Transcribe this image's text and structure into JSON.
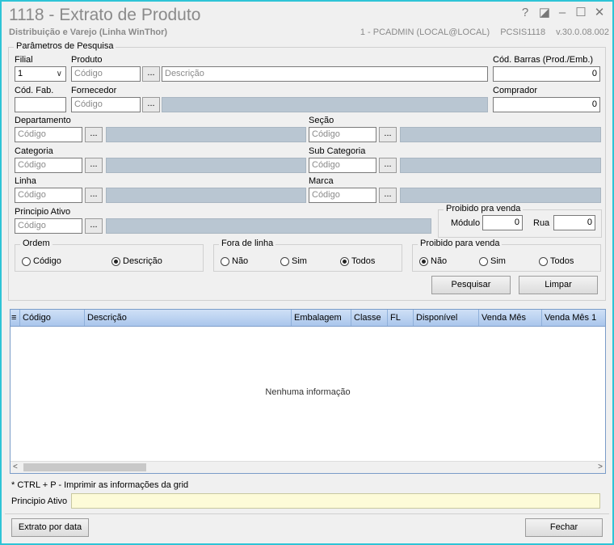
{
  "window": {
    "title": "1118 - Extrato de Produto",
    "subtitle": "Distribuição e Varejo (Linha WinThor)",
    "user": "1 - PCADMIN (LOCAL@LOCAL)",
    "module": "PCSIS1118",
    "version": "v.30.0.08.002",
    "controls": {
      "help": "?",
      "restore": "◪",
      "minimize": "–",
      "maximize": "☐",
      "close": "✕"
    }
  },
  "params": {
    "group_title": "Parâmetros de Pesquisa",
    "filial": {
      "label": "Filial",
      "value": "1"
    },
    "produto": {
      "label": "Produto",
      "code_placeholder": "Código",
      "desc_placeholder": "Descrição"
    },
    "cod_barras": {
      "label": "Cód. Barras (Prod./Emb.)",
      "value": "0"
    },
    "cod_fab": {
      "label": "Cód. Fab.",
      "value": ""
    },
    "fornecedor": {
      "label": "Fornecedor",
      "code_placeholder": "Código"
    },
    "comprador": {
      "label": "Comprador",
      "value": "0"
    },
    "departamento": {
      "label": "Departamento",
      "code_placeholder": "Código"
    },
    "secao": {
      "label": "Seção",
      "code_placeholder": "Código"
    },
    "categoria": {
      "label": "Categoria",
      "code_placeholder": "Código"
    },
    "sub_categoria": {
      "label": "Sub Categoria",
      "code_placeholder": "Código"
    },
    "linha": {
      "label": "Linha",
      "code_placeholder": "Código"
    },
    "marca": {
      "label": "Marca",
      "code_placeholder": "Código"
    },
    "principio_ativo": {
      "label": "Principio Ativo",
      "code_placeholder": "Código"
    },
    "dots": "...",
    "proibido_group": {
      "title": "Proibido pra venda",
      "modulo_label": "Módulo",
      "modulo_value": "0",
      "rua_label": "Rua",
      "rua_value": "0"
    },
    "ordem": {
      "title": "Ordem",
      "options": [
        "Código",
        "Descrição"
      ],
      "selected": 1
    },
    "fora_de_linha": {
      "title": "Fora de linha",
      "options": [
        "Não",
        "Sim",
        "Todos"
      ],
      "selected": 2
    },
    "proibido_venda": {
      "title": "Proibido para venda",
      "options": [
        "Não",
        "Sim",
        "Todos"
      ],
      "selected": 0
    },
    "pesquisar_label": "Pesquisar",
    "limpar_label": "Limpar"
  },
  "grid": {
    "columns": [
      "Código",
      "Descrição",
      "Embalagem",
      "Classe",
      "FL",
      "Disponível",
      "Venda Mês",
      "Venda Mês 1"
    ],
    "empty_text": "Nenhuma informação",
    "scroll_left": "<",
    "scroll_right": ">"
  },
  "hint": "* CTRL + P - Imprimir as informações da grid",
  "principio_ativo_footer": {
    "label": "Principio Ativo",
    "value": ""
  },
  "buttons": {
    "extrato_por_data": "Extrato por data",
    "fechar": "Fechar"
  }
}
